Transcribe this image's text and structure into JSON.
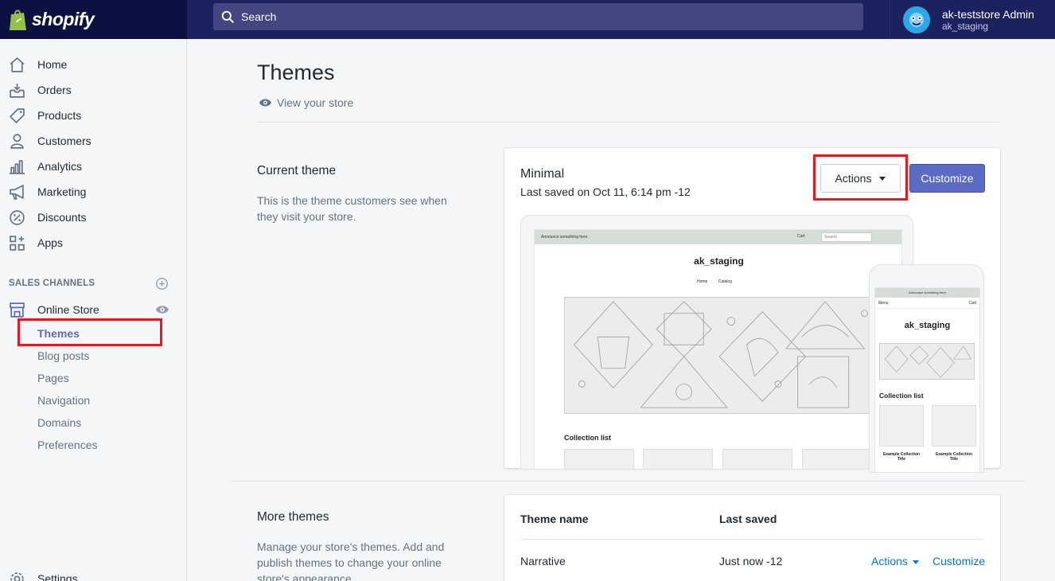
{
  "topbar": {
    "brand": "shopify",
    "search_placeholder": "Search",
    "account_name": "ak-teststore Admin",
    "account_store": "ak_staging"
  },
  "sidebar": {
    "items": [
      {
        "label": "Home",
        "icon": "home-icon"
      },
      {
        "label": "Orders",
        "icon": "orders-icon"
      },
      {
        "label": "Products",
        "icon": "tag-icon"
      },
      {
        "label": "Customers",
        "icon": "person-icon"
      },
      {
        "label": "Analytics",
        "icon": "bar-chart-icon"
      },
      {
        "label": "Marketing",
        "icon": "megaphone-icon"
      },
      {
        "label": "Discounts",
        "icon": "discount-icon"
      },
      {
        "label": "Apps",
        "icon": "apps-icon"
      }
    ],
    "section_title": "SALES CHANNELS",
    "online_store": "Online Store",
    "sub_items": [
      "Themes",
      "Blog posts",
      "Pages",
      "Navigation",
      "Domains",
      "Preferences"
    ],
    "settings": "Settings"
  },
  "main": {
    "title": "Themes",
    "view_store": "View your store",
    "current_theme": {
      "heading": "Current theme",
      "description": "This is the theme customers see when they visit your store.",
      "name": "Minimal",
      "last_saved": "Last saved on Oct 11, 6:14 pm -12",
      "actions_label": "Actions",
      "customize_label": "Customize"
    },
    "preview": {
      "announcement": "Announce something here",
      "cart": "Cart",
      "search": "Search",
      "store_title": "ak_staging",
      "nav": [
        "Home",
        "Catalog"
      ],
      "collection_heading": "Collection list",
      "menu": "Menu",
      "collection_caption": "Example Collection Title"
    },
    "more_themes": {
      "heading": "More themes",
      "description": "Manage your store's themes. Add and publish themes to change your online store's appearance.",
      "columns": [
        "Theme name",
        "Last saved"
      ],
      "rows": [
        {
          "name": "Narrative",
          "saved": "Just now -12",
          "actions": "Actions",
          "customize": "Customize"
        }
      ]
    }
  },
  "colors": {
    "topbar": "#1c2260",
    "accent": "#5c6ac4",
    "link": "#007ace",
    "highlight_box": "#e01b22"
  }
}
